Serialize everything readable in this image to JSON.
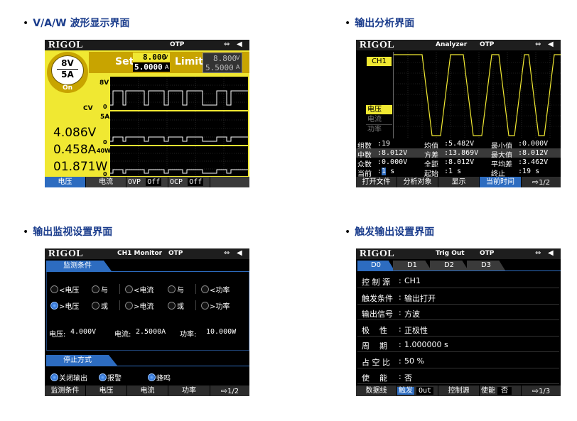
{
  "captions": {
    "p1": "V/A/W 波形显示界面",
    "p2": "输出分析界面",
    "p3": "输出监视设置界面",
    "p4": "触发输出设置界面"
  },
  "bullet": "•",
  "logo": "RIGOL",
  "otp": "OTP",
  "usb_icon": "⇔",
  "speaker_icon": "◀",
  "wave": {
    "badge_v": "8V",
    "badge_a": "5A",
    "badge_state": "On",
    "set_label": "Set",
    "set_v": "8.000",
    "set_v_unit": "V",
    "set_a": "5.0000",
    "set_a_unit": "A",
    "limit_label": "Limit",
    "limit_v": "8.800",
    "limit_v_unit": "V",
    "limit_a": "5.5000",
    "limit_a_unit": "A",
    "axis_8v": "8V",
    "axis_cv": "CV",
    "axis_0a": "0",
    "axis_5a": "5A",
    "axis_0b": "0",
    "axis_40w": "40W",
    "axis_0c": "0",
    "meas_v": "4.086V",
    "meas_a": "0.458A",
    "meas_w": "01.871W",
    "foot": {
      "voltage": "电压",
      "current": "电流",
      "ovp": "OVP",
      "ovp_val": "Off",
      "ocp": "OCP",
      "ocp_val": "Off"
    },
    "colors": {
      "yellow": "#f0e832",
      "gold": "#c8a400"
    }
  },
  "analyzer": {
    "title": "Analyzer",
    "ch": "CH1",
    "sel_voltage": "电压",
    "sel_current": "电流",
    "sel_power": "功率",
    "rows": [
      [
        {
          "l": "组数",
          "v": ":19"
        },
        {
          "l": "均值",
          "v": ":5.482V"
        },
        {
          "l": "最小值",
          "v": ":0.000V"
        }
      ],
      [
        {
          "l": "中数",
          "v": ":8.012V"
        },
        {
          "l": "方差",
          "v": ":13.869V"
        },
        {
          "l": "最大值",
          "v": ":8.012V"
        }
      ],
      [
        {
          "l": "众数",
          "v": ":0.000V"
        },
        {
          "l": "全距",
          "v": ":8.012V"
        },
        {
          "l": "平均差",
          "v": ":3.462V"
        }
      ],
      [
        {
          "l": "当前",
          "v": ":1 s"
        },
        {
          "l": "起始",
          "v": ":1 s"
        },
        {
          "l": "终止",
          "v": ":19 s"
        }
      ]
    ],
    "current_val": "1",
    "foot": {
      "open_file": "打开文件",
      "analyze_obj": "分析对象",
      "display": "显示",
      "cur_time": "当前时间",
      "page": "1/2"
    }
  },
  "monitor": {
    "title": "CH1 Monitor",
    "cond_tab": "监测条件",
    "row1": [
      "<电压",
      "与",
      "<电流",
      "与",
      "<功率"
    ],
    "row2": [
      ">电压",
      "或",
      ">电流",
      "或",
      ">功率"
    ],
    "voltage_label": "电压:",
    "voltage_val": "4.000V",
    "current_label": "电流:",
    "current_val": "2.5000A",
    "power_label": "功率:",
    "power_val": "10.000W",
    "stop_tab": "停止方式",
    "stop_opts": [
      "关闭输出",
      "报警",
      "蜂鸣"
    ],
    "foot": {
      "cond": "监测条件",
      "voltage": "电压",
      "current": "电流",
      "power": "功率",
      "page": "1/2"
    }
  },
  "trig": {
    "title": "Trig Out",
    "tabs": [
      "D0",
      "D1",
      "D2",
      "D3"
    ],
    "rows": [
      {
        "label": "控 制 源",
        "value": "CH1"
      },
      {
        "label": "触发条件",
        "value": "输出打开"
      },
      {
        "label": "输出信号",
        "value": "方波"
      },
      {
        "label": "极    性",
        "value": "正极性"
      },
      {
        "label": "周    期",
        "value": "1.000000 s"
      },
      {
        "label": "占 空 比",
        "value": "50 %"
      },
      {
        "label": "使    能",
        "value": "否"
      }
    ],
    "foot": {
      "data_line": "数据线",
      "trigger": "触发",
      "trigger_val": "Out",
      "ctrl_src": "控制源",
      "enable": "使能",
      "enable_val": "否",
      "page": "1/3"
    }
  }
}
